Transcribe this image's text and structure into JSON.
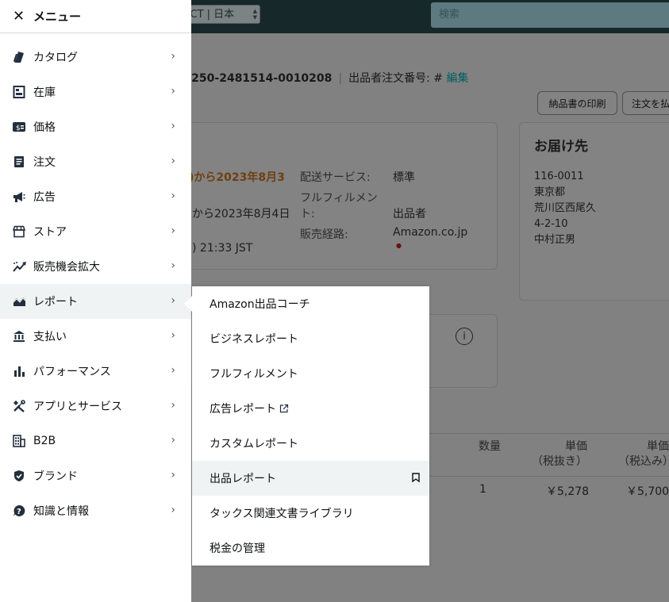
{
  "menu": {
    "close_icon": "close-icon",
    "title": "メニュー",
    "items": [
      {
        "label": "カタログ",
        "icon": "catalog-icon"
      },
      {
        "label": "在庫",
        "icon": "inventory-icon"
      },
      {
        "label": "価格",
        "icon": "price-icon"
      },
      {
        "label": "注文",
        "icon": "orders-icon"
      },
      {
        "label": "広告",
        "icon": "megaphone-icon"
      },
      {
        "label": "ストア",
        "icon": "store-icon"
      },
      {
        "label": "販売機会拡大",
        "icon": "growth-icon"
      },
      {
        "label": "レポート",
        "icon": "reports-icon",
        "active": true
      },
      {
        "label": "支払い",
        "icon": "bank-icon"
      },
      {
        "label": "パフォーマンス",
        "icon": "bar-chart-icon"
      },
      {
        "label": "アプリとサービス",
        "icon": "tools-icon"
      },
      {
        "label": "B2B",
        "icon": "building-icon"
      },
      {
        "label": "ブランド",
        "icon": "shield-icon"
      },
      {
        "label": "知識と情報",
        "icon": "help-icon"
      }
    ]
  },
  "submenu": {
    "items": [
      {
        "label": "Amazon出品コーチ"
      },
      {
        "label": "ビジネスレポート"
      },
      {
        "label": "フルフィルメント"
      },
      {
        "label": "広告レポート",
        "external": true
      },
      {
        "label": "カスタムレポート"
      },
      {
        "label": "出品レポート",
        "highlighted": true,
        "bookmark": true
      },
      {
        "label": "タックス関連文書ライブラリ"
      },
      {
        "label": "税金の管理"
      }
    ]
  },
  "background": {
    "marketplace_select": "UCT | 日本",
    "search_placeholder": "検索",
    "order_prefix": ": ",
    "order_number": "250-2481514-0010208",
    "seller_order_label": "出品者注文番号: #",
    "edit_link": "編集",
    "print_button": "納品書の印刷",
    "refund_button": "注文を払",
    "summary": {
      "deliver_range": ")から2023年8月3",
      "ship_range": "から2023年8月4日",
      "purchase_time": ") 21:33 JST",
      "shipping_service_label": "配送サービス:",
      "shipping_service_value": "標準",
      "fulfillment_label_1": "フルフィルメン",
      "fulfillment_label_2": "ト:",
      "fulfillment_value": "出品者",
      "channel_label": "販売経路:",
      "channel_value": "Amazon.co.jp",
      "flag": "●"
    },
    "ship_to": {
      "title": "お届け先",
      "postal": "116-0011",
      "prefecture": "東京都",
      "city": "荒川区西尾久",
      "street": "4-2-10",
      "name": "中村正男"
    },
    "info_icon": "i",
    "table": {
      "qty_header": "数量",
      "unit_ex_header_1": "単価",
      "unit_ex_header_2": "（税抜き）",
      "unit_in_header_1": "単価",
      "unit_in_header_2": "（税込み）",
      "qty": "1",
      "unit_ex": "￥5,278",
      "unit_in": "￥5,700"
    }
  }
}
